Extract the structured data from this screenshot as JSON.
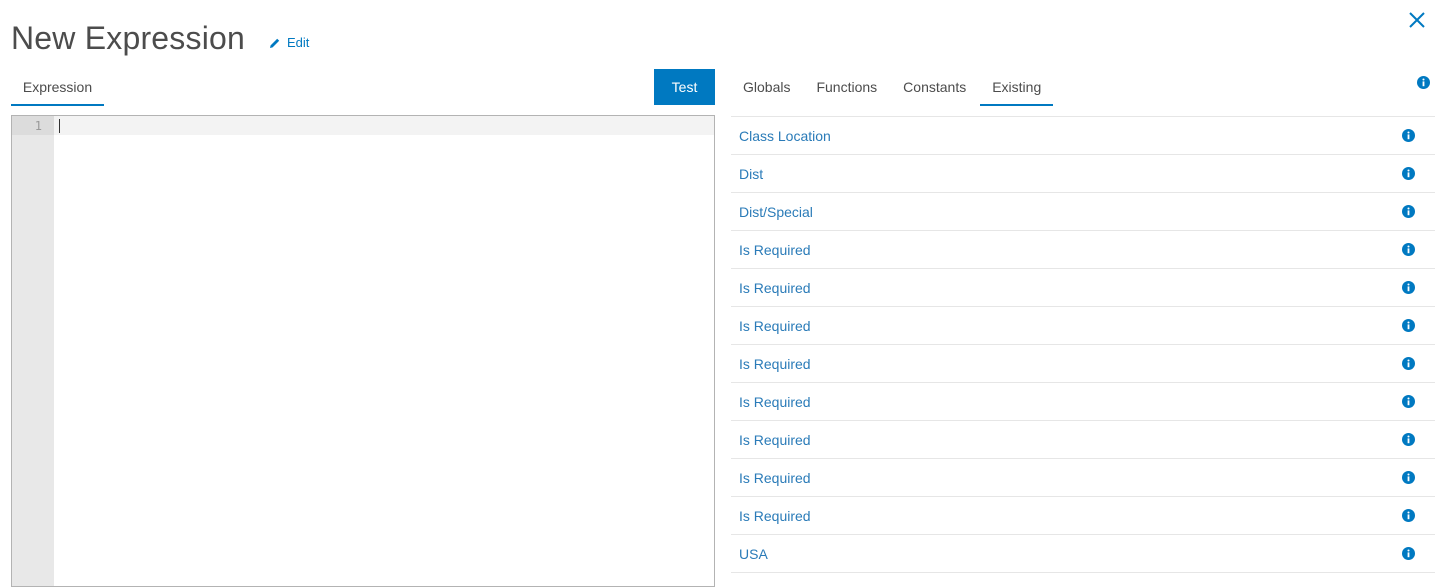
{
  "header": {
    "title": "New Expression",
    "edit_label": "Edit"
  },
  "editor": {
    "tab_label": "Expression",
    "test_label": "Test",
    "line_numbers": [
      "1"
    ]
  },
  "panel": {
    "tabs": [
      {
        "label": "Globals",
        "active": false
      },
      {
        "label": "Functions",
        "active": false
      },
      {
        "label": "Constants",
        "active": false
      },
      {
        "label": "Existing",
        "active": true
      }
    ],
    "items": [
      {
        "label": "Class Location"
      },
      {
        "label": "Dist"
      },
      {
        "label": "Dist/Special"
      },
      {
        "label": "Is Required"
      },
      {
        "label": "Is Required"
      },
      {
        "label": "Is Required"
      },
      {
        "label": "Is Required"
      },
      {
        "label": "Is Required"
      },
      {
        "label": "Is Required"
      },
      {
        "label": "Is Required"
      },
      {
        "label": "Is Required"
      },
      {
        "label": "USA"
      }
    ]
  },
  "icons": {
    "close": "close-icon",
    "edit": "pencil-icon",
    "info": "info-icon"
  },
  "colors": {
    "accent": "#0079c1",
    "link": "#2a7bb8"
  }
}
